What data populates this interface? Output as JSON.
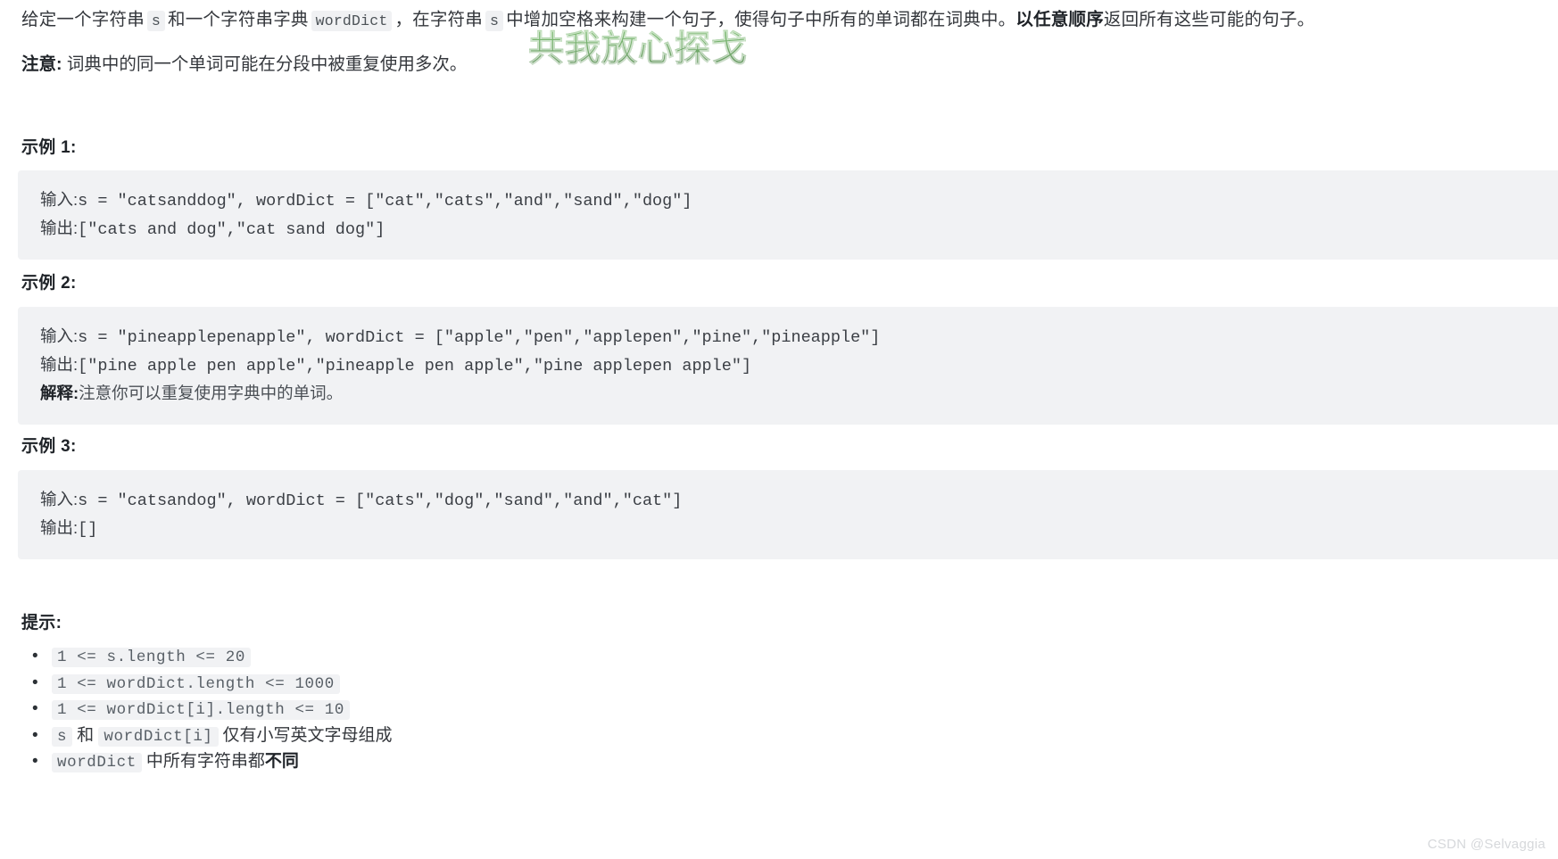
{
  "intro": {
    "p1": "给定一个字符串",
    "code_s1": "s",
    "p2": "和一个字符串字典",
    "code_worddict": "wordDict",
    "p3": "，在字符串",
    "code_s2": "s",
    "p4": "中增加空格来构建一个句子，使得句子中所有的单词都在词典中。",
    "bold_phrase": "以任意顺序",
    "p5": "返回所有这些可能的句子。"
  },
  "note": {
    "label": "注意:",
    "text": "词典中的同一个单词可能在分段中被重复使用多次。"
  },
  "examples": [
    {
      "heading": "示例 1:",
      "lines": [
        {
          "zh": "输入:",
          "code": "s = \"catsanddog\", wordDict = [\"cat\",\"cats\",\"and\",\"sand\",\"dog\"]"
        },
        {
          "zh": "输出:",
          "code": "[\"cats and dog\",\"cat sand dog\"]"
        }
      ]
    },
    {
      "heading": "示例 2:",
      "lines": [
        {
          "zh": "输入:",
          "code": "s = \"pineapplepenapple\", wordDict = [\"apple\",\"pen\",\"applepen\",\"pine\",\"pineapple\"]"
        },
        {
          "zh": "输出:",
          "code": "[\"pine apple pen apple\",\"pineapple pen apple\",\"pine applepen apple\"]"
        }
      ],
      "explanation_label": "解释:",
      "explanation_text": "注意你可以重复使用字典中的单词。"
    },
    {
      "heading": "示例 3:",
      "lines": [
        {
          "zh": "输入:",
          "code": "s = \"catsandog\", wordDict = [\"cats\",\"dog\",\"sand\",\"and\",\"cat\"]"
        },
        {
          "zh": "输出:",
          "code": "[]"
        }
      ]
    }
  ],
  "hints": {
    "heading": "提示:",
    "items": [
      {
        "code": "1 <= s.length <= 20",
        "tail": "",
        "tail_bold": ""
      },
      {
        "code": "1 <= wordDict.length <= 1000",
        "tail": "",
        "tail_bold": ""
      },
      {
        "code": "1 <= wordDict[i].length <= 10",
        "tail": "",
        "tail_bold": ""
      },
      {
        "code": "s",
        "mid": "和",
        "code2": "wordDict[i]",
        "tail": "仅有小写英文字母组成",
        "tail_bold": ""
      },
      {
        "code": "wordDict",
        "tail": "中所有字符串都",
        "tail_bold": "不同"
      }
    ]
  },
  "watermarks": {
    "green_text": "共我放心探戈",
    "green_color": "#2f8b22",
    "csdn_text": "CSDN @Selvaggia",
    "csdn_color": "#d6d8db"
  }
}
